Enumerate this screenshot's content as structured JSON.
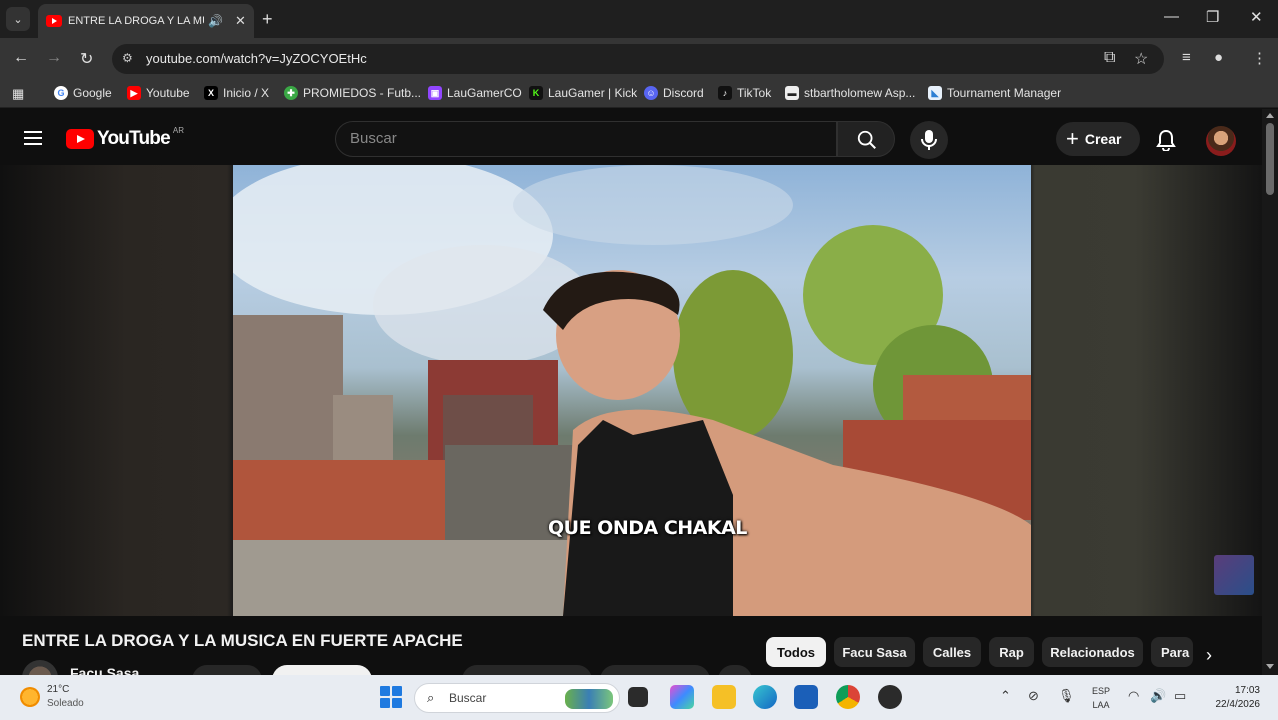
{
  "browser": {
    "tab_title": "ENTRE LA DROGA Y LA MUSICA EN FUERTE APACHE",
    "url": "youtube.com/watch?v=JyZOCYOEtHc"
  },
  "bookmarks": [
    {
      "label": "Google",
      "icon": "google-icon",
      "color": "#4285f4"
    },
    {
      "label": "Youtube",
      "icon": "youtube-icon",
      "color": "#ff0000"
    },
    {
      "label": "Inicio / X",
      "icon": "x-icon",
      "color": "#000000"
    },
    {
      "label": "PROMIEDOS - Futb...",
      "icon": "promiedos-icon",
      "color": "#3aa845"
    },
    {
      "label": "LauGamerCO",
      "icon": "twitch-icon",
      "color": "#9146ff"
    },
    {
      "label": "LauGamer | Kick",
      "icon": "kick-icon",
      "color": "#53fc18"
    },
    {
      "label": "Discord",
      "icon": "discord-icon",
      "color": "#5865f2"
    },
    {
      "label": "TikTok",
      "icon": "tiktok-icon",
      "color": "#111111"
    },
    {
      "label": "stbartholomew Asp...",
      "icon": "site-icon",
      "color": "#444444"
    },
    {
      "label": "Tournament Manager",
      "icon": "doc-icon",
      "color": "#2d7fd3"
    }
  ],
  "youtube": {
    "region": "AR",
    "logo_text": "YouTube",
    "search_placeholder": "Buscar",
    "create_label": "Crear",
    "subtitle": "QUE ONDA CHAKAL",
    "video_title": "ENTRE LA DROGA Y LA MUSICA EN FUERTE APACHE",
    "channel_name": "Facu Sasa",
    "chips": [
      "Todos",
      "Facu Sasa",
      "Calles",
      "Rap",
      "Relacionados",
      "Para"
    ],
    "active_chip": "Todos"
  },
  "taskbar": {
    "weather_temp": "21°C",
    "weather_desc": "Soleado",
    "search_placeholder": "Buscar",
    "lang_line1": "ESP",
    "lang_line2": "LAA",
    "time": "17:03",
    "date": "22/4/2026"
  },
  "colors": {
    "youtube_red": "#ff0000",
    "page_bg": "#0f0f0f",
    "chip_bg": "#272727"
  }
}
